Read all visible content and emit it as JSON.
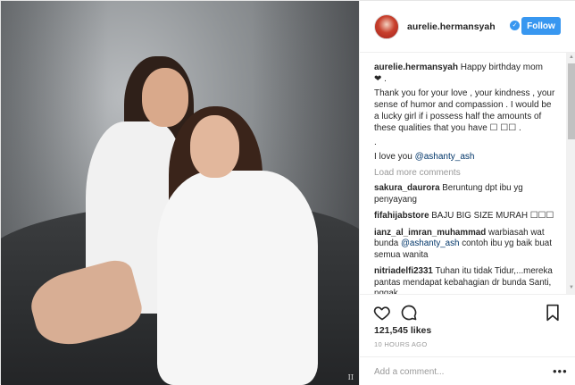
{
  "post": {
    "username": "aurelie.hermansyah",
    "follow_label": "Follow",
    "verified_glyph": "✓"
  },
  "photo": {
    "watermark": "II"
  },
  "caption": {
    "username": "aurelie.hermansyah",
    "line1": "Happy birthday mom",
    "line1b": "❤ .",
    "body": "Thank you for your love , your kindness , your sense of humor and compassion . I would be a lucky girl if i possess half the amounts of these qualities that you have ☐ ☐☐ .",
    "dot": ".",
    "love_text": "I love you ",
    "love_mention": "@ashanty_ash"
  },
  "load_more": "Load more comments",
  "comments": [
    {
      "user": "sakura_daurora",
      "text": "Beruntung dpt ibu yg penyayang",
      "mention": "",
      "text2": ""
    },
    {
      "user": "fifahijabstore",
      "text": "BAJU BIG SIZE MURAH ☐☐☐",
      "mention": "",
      "text2": ""
    },
    {
      "user": "ianz_al_imran_muhammad",
      "text": "warbiasah wat bunda ",
      "mention": "@ashanty_ash",
      "text2": " contoh ibu yg baik buat semua wanita"
    },
    {
      "user": "nitriadelfi2331",
      "text": "Tuhan itu tidak Tidur,...mereka pantas mendapat kebahagian dr bunda Santi, nggak",
      "mention": "",
      "text2": ""
    }
  ],
  "likes": "121,545 likes",
  "time": "10 HOURS AGO",
  "add_comment_placeholder": "Add a comment...",
  "more_glyph": "•••",
  "scroll": {
    "up": "▲",
    "down": "▼"
  },
  "icons": {
    "heart": "heart-icon",
    "comment": "comment-icon",
    "bookmark": "bookmark-icon",
    "more": "more-icon",
    "verified": "verified-icon"
  },
  "colors": {
    "accent": "#3897f0",
    "text": "#262626",
    "muted": "#999999",
    "mention": "#003569"
  }
}
